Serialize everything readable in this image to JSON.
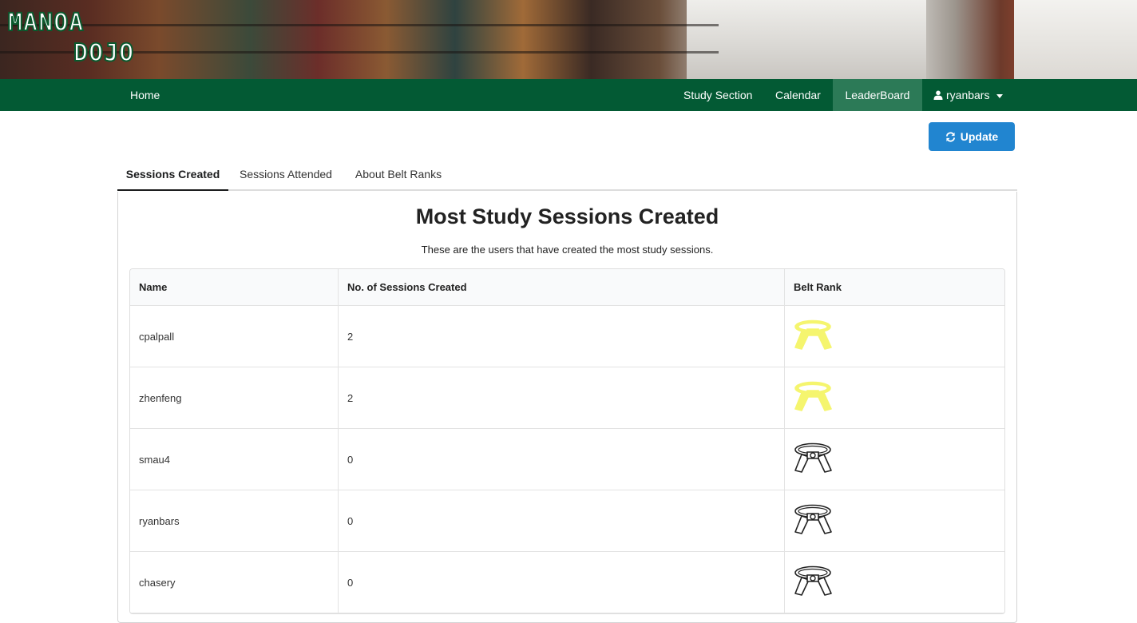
{
  "logo": {
    "line1": "MANOA",
    "line2": "DOJO"
  },
  "nav": {
    "home": "Home",
    "study_section": "Study Section",
    "calendar": "Calendar",
    "leaderboard": "LeaderBoard",
    "user": "ryanbars"
  },
  "update_label": "Update",
  "tabs": [
    "Sessions Created",
    "Sessions Attended",
    "About Belt Ranks"
  ],
  "heading": "Most Study Sessions Created",
  "subheading": "These are the users that have created the most study sessions.",
  "table": {
    "columns": [
      "Name",
      "No. of Sessions Created",
      "Belt Rank"
    ],
    "rows": [
      {
        "name": "cpalpall",
        "count": "2",
        "belt": "yellow"
      },
      {
        "name": "zhenfeng",
        "count": "2",
        "belt": "yellow"
      },
      {
        "name": "smau4",
        "count": "0",
        "belt": "white"
      },
      {
        "name": "ryanbars",
        "count": "0",
        "belt": "white"
      },
      {
        "name": "chasery",
        "count": "0",
        "belt": "white"
      }
    ]
  },
  "colors": {
    "nav": "#035a34",
    "nav_active": "#2c7a57",
    "button": "#2185d0",
    "yellow_belt": "#f5f56e",
    "white_belt": "#ffffff"
  }
}
